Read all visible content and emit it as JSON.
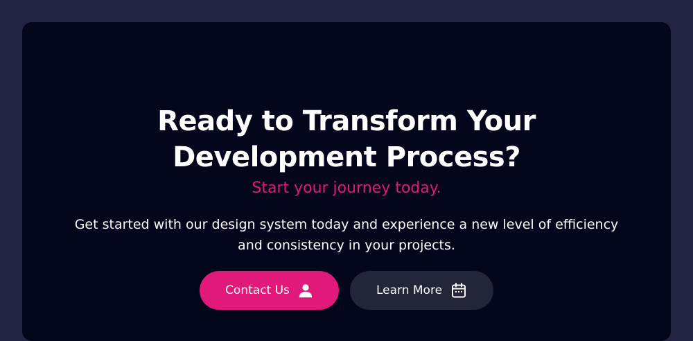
{
  "cta": {
    "headline": "Ready to Transform Your Development Process?",
    "subheadline": "Start your journey today.",
    "description": "Get started with our design system today and experience a new level of efficiency and consistency in your projects."
  },
  "buttons": {
    "primary": {
      "label": "Contact Us",
      "icon": "user-icon"
    },
    "secondary": {
      "label": "Learn More",
      "icon": "calendar-icon"
    }
  },
  "colors": {
    "page_background": "#212340",
    "card_background": "#04061c",
    "accent": "#e0197a",
    "secondary_button": "#232538",
    "text": "#ffffff"
  }
}
